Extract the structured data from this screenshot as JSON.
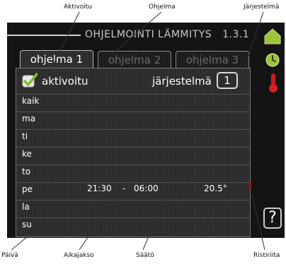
{
  "callouts": {
    "aktivoitu": "Aktivoitu",
    "ohjelma": "Ohjelma",
    "jarjestelma": "Järjestelmä",
    "paiva": "Päivä",
    "aikajakso": "Aikajakso",
    "saato": "Säätö",
    "ristiriita": "Ristiriita"
  },
  "header": {
    "title": "OHJELMOINTI LÄMMITYS",
    "menu_number": "1.3.1"
  },
  "tabs": [
    {
      "label": "ohjelma 1",
      "active": true
    },
    {
      "label": "ohjelma 2",
      "active": false
    },
    {
      "label": "ohjelma 3",
      "active": false
    }
  ],
  "activated_label": "aktivoitu",
  "system": {
    "label": "järjestelmä",
    "value": "1"
  },
  "days": [
    {
      "day": "kaik",
      "start": "",
      "dash": "",
      "end": "",
      "temp": ""
    },
    {
      "day": "ma",
      "start": "",
      "dash": "",
      "end": "",
      "temp": ""
    },
    {
      "day": "ti",
      "start": "",
      "dash": "",
      "end": "",
      "temp": ""
    },
    {
      "day": "ke",
      "start": "",
      "dash": "",
      "end": "",
      "temp": ""
    },
    {
      "day": "to",
      "start": "",
      "dash": "",
      "end": "",
      "temp": ""
    },
    {
      "day": "pe",
      "start": "21:30",
      "dash": "-",
      "end": "06:00",
      "temp": "20.5°"
    },
    {
      "day": "la",
      "start": "",
      "dash": "",
      "end": "",
      "temp": ""
    },
    {
      "day": "su",
      "start": "",
      "dash": "",
      "end": "",
      "temp": ""
    }
  ],
  "conflict_mark": "!",
  "help_label": "?",
  "icons": {
    "house": "house-icon",
    "clock": "clock-icon",
    "thermometer": "thermometer-icon",
    "check": "check-icon"
  },
  "colors": {
    "accent_green": "#7fbf2a",
    "conflict_red": "#d40000"
  }
}
